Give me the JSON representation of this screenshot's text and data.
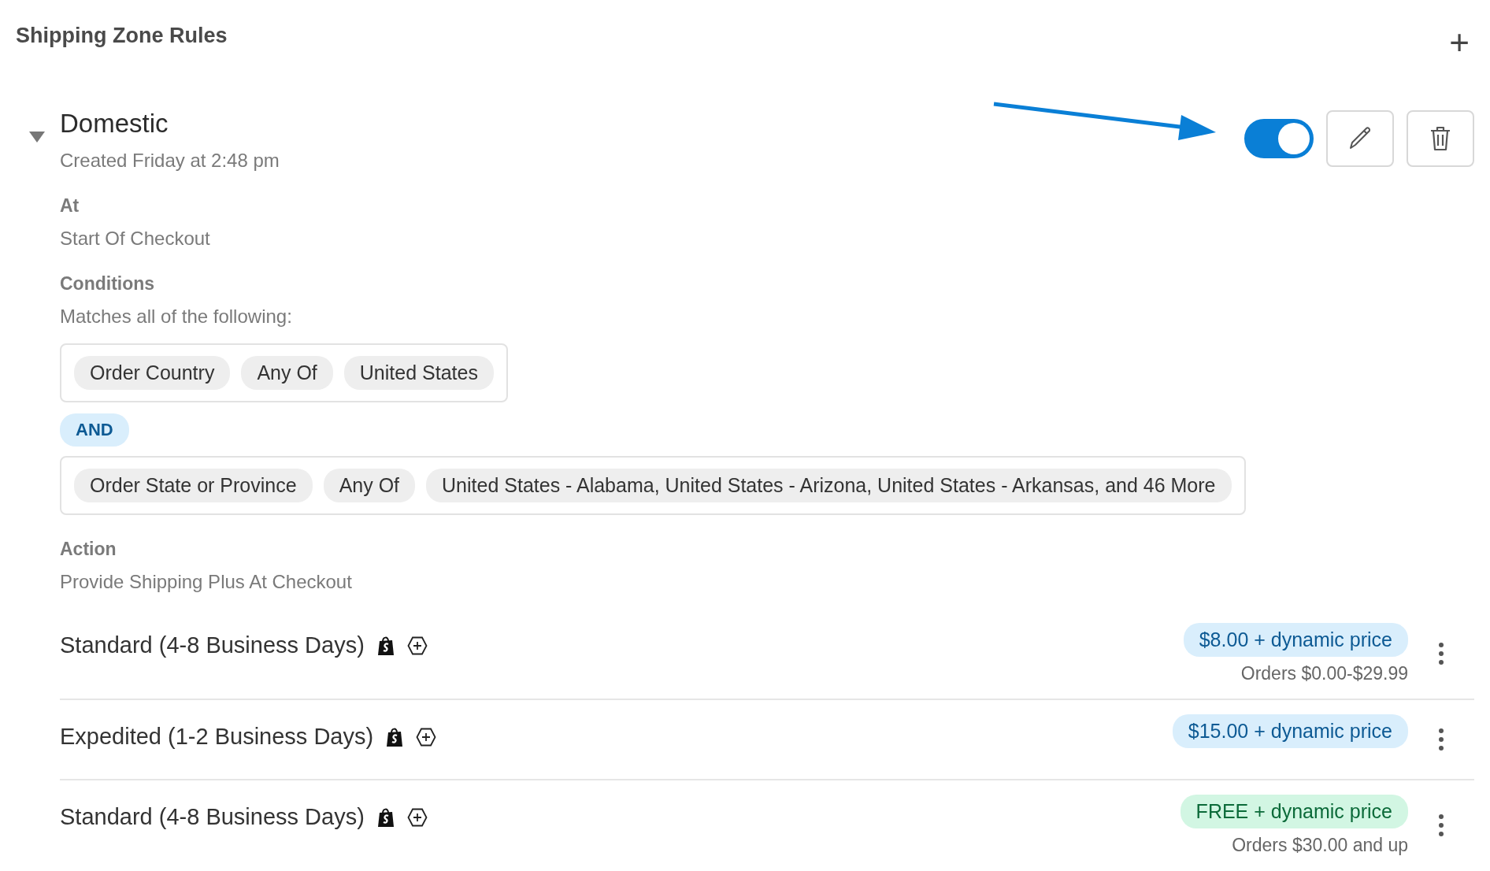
{
  "page": {
    "title": "Shipping Zone Rules",
    "add_icon": "+"
  },
  "rule": {
    "expanded": true,
    "name": "Domestic",
    "created": "Created Friday at 2:48 pm",
    "enabled": true,
    "at": {
      "label": "At",
      "value": "Start Of Checkout"
    },
    "conditions": {
      "label": "Conditions",
      "summary": "Matches all of the following:",
      "joiner": "AND",
      "groups": [
        {
          "chips": [
            "Order Country",
            "Any Of",
            "United States"
          ]
        },
        {
          "chips": [
            "Order State or Province",
            "Any Of",
            "United States - Alabama, United States - Arizona, United States - Arkansas, and 46 More"
          ]
        }
      ]
    },
    "action": {
      "label": "Action",
      "value": "Provide Shipping Plus At Checkout"
    },
    "methods": [
      {
        "name": "Standard (4-8 Business Days)",
        "price": "$8.00 + dynamic price",
        "kind": "paid",
        "range": "Orders $0.00-$29.99"
      },
      {
        "name": "Expedited (1-2 Business Days)",
        "price": "$15.00 + dynamic price",
        "kind": "paid"
      },
      {
        "name": "Standard (4-8 Business Days)",
        "price": "FREE + dynamic price",
        "kind": "free",
        "range": "Orders $30.00 and up"
      }
    ]
  }
}
